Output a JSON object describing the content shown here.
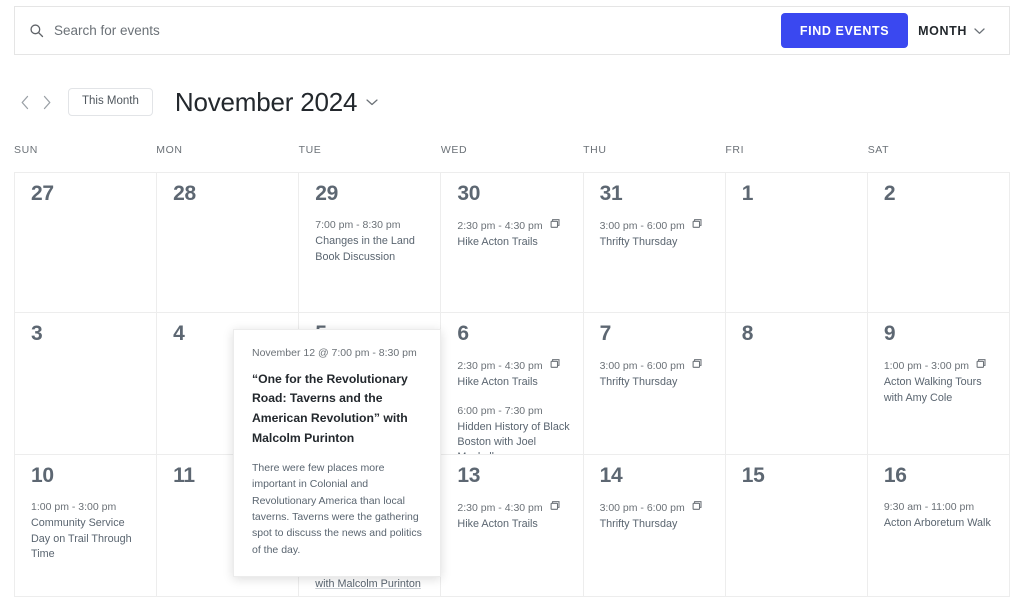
{
  "search": {
    "placeholder": "Search for events",
    "value": "",
    "icon": "search-icon",
    "find_events_label": "FIND EVENTS",
    "view_label": "MONTH",
    "view_chevron_icon": "chevron-down-icon",
    "accent_color": "#3a48f0"
  },
  "nav": {
    "prev_icon": "chevron-left-icon",
    "next_icon": "chevron-right-icon",
    "this_month_label": "This Month",
    "month_title": "November 2024",
    "month_chevron_icon": "chevron-down-icon"
  },
  "weekdays": [
    "SUN",
    "MON",
    "TUE",
    "WED",
    "THU",
    "FRI",
    "SAT"
  ],
  "recurring_icon": "recurring-events-icon",
  "weeks": [
    {
      "days": [
        {
          "num": "27",
          "events": []
        },
        {
          "num": "28",
          "events": []
        },
        {
          "num": "29",
          "events": [
            {
              "time": "7:00 pm - 8:30 pm",
              "recurring": false,
              "title": "Changes in the Land Book Discussion"
            }
          ]
        },
        {
          "num": "30",
          "events": [
            {
              "time": "2:30 pm - 4:30 pm",
              "recurring": true,
              "title": "Hike Acton Trails"
            }
          ]
        },
        {
          "num": "31",
          "events": [
            {
              "time": "3:00 pm - 6:00 pm",
              "recurring": true,
              "title": "Thrifty Thursday"
            }
          ]
        },
        {
          "num": "1",
          "events": []
        },
        {
          "num": "2",
          "events": []
        }
      ]
    },
    {
      "days": [
        {
          "num": "3",
          "events": []
        },
        {
          "num": "4",
          "events": []
        },
        {
          "num": "5",
          "events": []
        },
        {
          "num": "6",
          "events": [
            {
              "time": "2:30 pm - 4:30 pm",
              "recurring": true,
              "title": "Hike Acton Trails"
            },
            {
              "time": "6:00 pm - 7:30 pm",
              "recurring": false,
              "title": "Hidden History of Black Boston with Joel Mackall"
            }
          ]
        },
        {
          "num": "7",
          "events": [
            {
              "time": "3:00 pm - 6:00 pm",
              "recurring": true,
              "title": "Thrifty Thursday"
            }
          ]
        },
        {
          "num": "8",
          "events": []
        },
        {
          "num": "9",
          "events": [
            {
              "time": "1:00 pm - 3:00 pm",
              "recurring": true,
              "title": "Acton Walking Tours with Amy Cole"
            }
          ]
        }
      ]
    },
    {
      "days": [
        {
          "num": "10",
          "events": [
            {
              "time": "1:00 pm - 3:00 pm",
              "recurring": false,
              "title": "Community Service Day on Trail Through Time"
            }
          ]
        },
        {
          "num": "11",
          "events": []
        },
        {
          "num": "12",
          "events": [
            {
              "time": "7:00 pm - 8:30 pm",
              "recurring": false,
              "hovered": true,
              "title": "“One for the Revolutionary Road: Taverns and the American Revolution” with Malcolm Purinton"
            }
          ]
        },
        {
          "num": "13",
          "events": [
            {
              "time": "2:30 pm - 4:30 pm",
              "recurring": true,
              "title": "Hike Acton Trails"
            }
          ]
        },
        {
          "num": "14",
          "events": [
            {
              "time": "3:00 pm - 6:00 pm",
              "recurring": true,
              "title": "Thrifty Thursday"
            }
          ]
        },
        {
          "num": "15",
          "events": []
        },
        {
          "num": "16",
          "events": [
            {
              "time": "9:30 am - 11:00 pm",
              "recurring": false,
              "title": "Acton Arboretum Walk"
            }
          ]
        }
      ]
    }
  ],
  "tooltip": {
    "date": "November 12 @ 7:00 pm - 8:30 pm",
    "title": "“One for the Revolutionary Road: Taverns and the American Revolution” with Malcolm Purinton",
    "excerpt": "There were few places more important in Colonial and Revolutionary America than local taverns. Taverns were the gathering spot to discuss the news and politics of the day."
  }
}
